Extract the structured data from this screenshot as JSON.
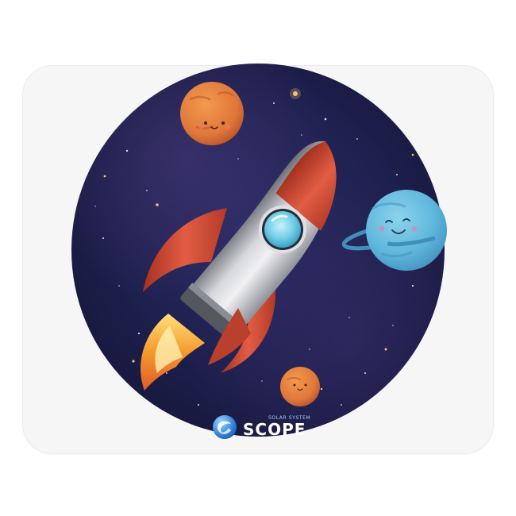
{
  "product": {
    "type": "mouse pad",
    "base_color": "#f6f6f7"
  },
  "artwork": {
    "background": "starry space",
    "elements": [
      "orange-planet",
      "rocket",
      "blue-ringed-planet",
      "small-orange-planet"
    ],
    "colors": {
      "space": "#1c1f4d",
      "rocket_body": "#d8d8dc",
      "rocket_red": "#d9513a",
      "planet_orange": "#e07b3a",
      "planet_blue": "#58b3d8"
    }
  },
  "brand": {
    "small_text": "SOLAR SYSTEM",
    "main_text": "SCOPE"
  }
}
